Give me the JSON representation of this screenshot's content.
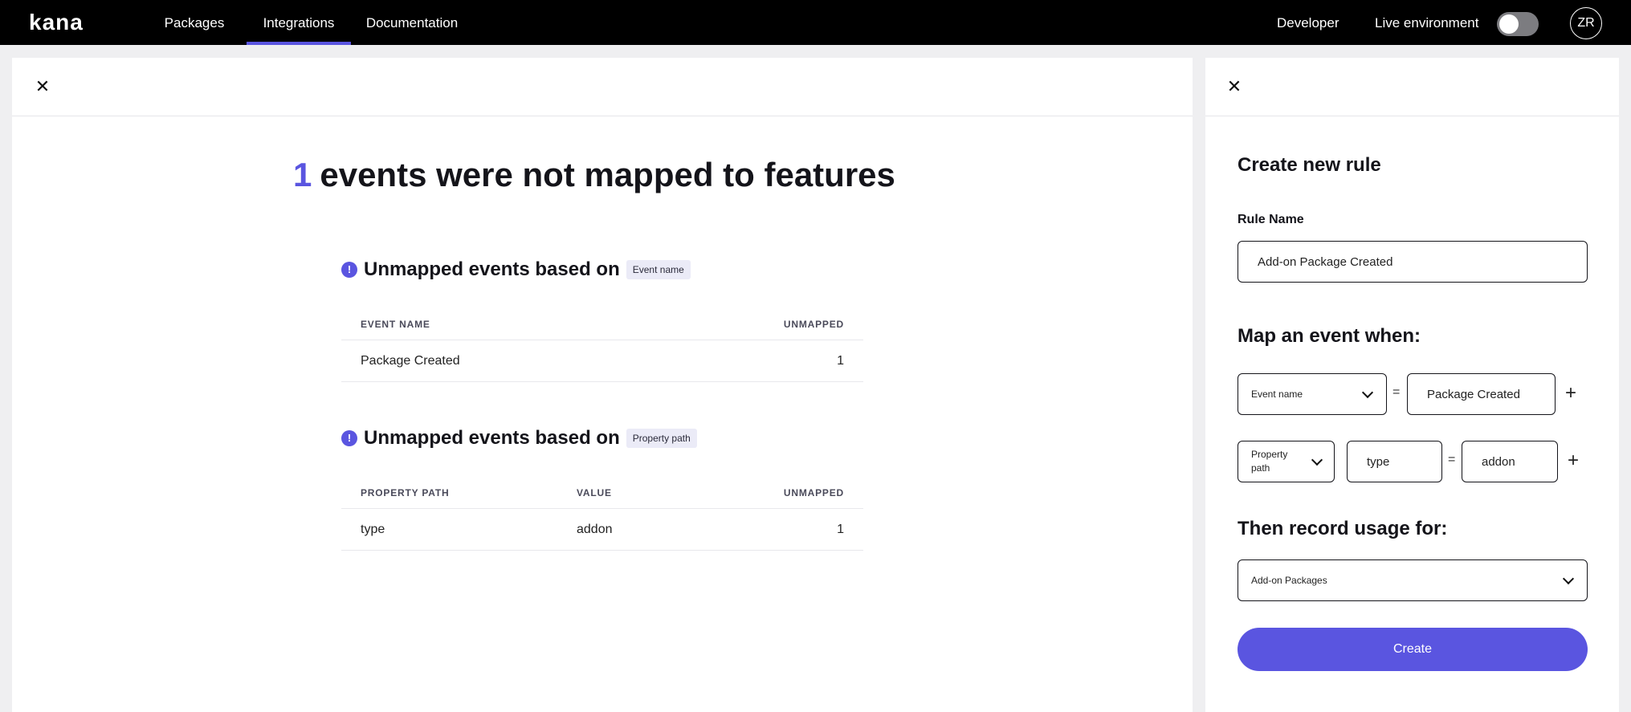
{
  "nav": {
    "logo": "kana",
    "links": [
      "Packages",
      "Integrations",
      "Documentation"
    ],
    "developer": "Developer",
    "live_env": "Live environment",
    "avatar_initials": "ZR",
    "accent": "#5a55e0"
  },
  "main": {
    "close_icon": "✕",
    "count": "1",
    "headline": "events were not mapped to features",
    "section1": {
      "title": "Unmapped events based on",
      "chip": "Event name",
      "headers": [
        "EVENT NAME",
        "UNMAPPED"
      ],
      "rows": [
        [
          "Package Created",
          "1"
        ]
      ]
    },
    "section2": {
      "title": "Unmapped events based on",
      "chip": "Property path",
      "headers": [
        "PROPERTY PATH",
        "VALUE",
        "UNMAPPED"
      ],
      "rows": [
        [
          "type",
          "addon",
          "1"
        ]
      ]
    }
  },
  "side": {
    "close_icon": "✕",
    "title": "Create new rule",
    "rule_name_label": "Rule Name",
    "rule_name_value": "Add-on Package Created",
    "map_title": "Map an event when:",
    "cond1": {
      "select": "Event name",
      "op": "=",
      "value": "Package Created",
      "add": "+"
    },
    "cond2": {
      "select": "Property path",
      "key": "type",
      "op": "=",
      "value": "addon",
      "add": "+"
    },
    "record_title": "Then record usage for:",
    "record_select": "Add-on Packages",
    "create_label": "Create"
  }
}
